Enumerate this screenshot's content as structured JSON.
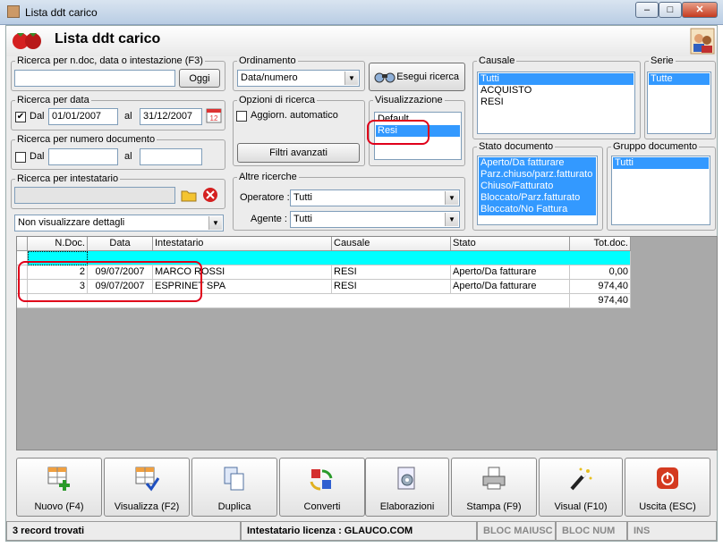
{
  "window": {
    "title": "Lista ddt carico",
    "min_glyph": "–",
    "max_glyph": "□",
    "close_glyph": "✕"
  },
  "header": {
    "title": "Lista ddt carico"
  },
  "search_text": {
    "legend": "Ricerca per n.doc, data o intestazione (F3)",
    "value": "",
    "today_button": "Oggi"
  },
  "ordering": {
    "legend": "Ordinamento",
    "selected": "Data/numero"
  },
  "search_button": {
    "label": "Esegui ricerca"
  },
  "date_search": {
    "legend": "Ricerca per data",
    "checked": true,
    "from_label": "Dal",
    "from_value": "01/01/2007",
    "to_label": "al",
    "to_value": "31/12/2007"
  },
  "search_options": {
    "legend": "Opzioni di ricerca",
    "auto_update_label": "Aggiorn. automatico",
    "advanced_filters": "Filtri avanzati"
  },
  "view": {
    "legend": "Visualizzazione",
    "items": [
      "Default",
      "Resi"
    ],
    "selected": "Resi"
  },
  "number_search": {
    "legend": "Ricerca per numero documento",
    "from_label": "Dal",
    "from_value": "",
    "to_label": "al",
    "to_value": ""
  },
  "holder_search": {
    "legend": "Ricerca per intestatario",
    "value": ""
  },
  "details": {
    "selected": "Non visualizzare dettagli"
  },
  "other_search": {
    "legend": "Altre ricerche",
    "operator_label": "Operatore :",
    "operator_value": "Tutti",
    "agent_label": "Agente :",
    "agent_value": "Tutti"
  },
  "causale": {
    "legend": "Causale",
    "items": [
      "Tutti",
      "ACQUISTO",
      "RESI"
    ],
    "selected": "Tutti"
  },
  "serie": {
    "legend": "Serie",
    "items": [
      "Tutte"
    ],
    "selected": "Tutte"
  },
  "stato": {
    "legend": "Stato documento",
    "items": [
      "Aperto/Da fatturare",
      "Parz.chiuso/parz.fatturato",
      "Chiuso/Fatturato",
      "Bloccato/Parz.fatturato",
      "Bloccato/No Fattura"
    ]
  },
  "gruppo": {
    "legend": "Gruppo documento",
    "items": [
      "Tutti"
    ],
    "selected": "Tutti"
  },
  "table": {
    "headers": [
      "N.Doc.",
      "Data",
      "Intestatario",
      "Causale",
      "Stato",
      "Tot.doc."
    ],
    "rows": [
      [
        "2",
        "09/07/2007",
        "MARCO ROSSI",
        "RESI",
        "Aperto/Da fatturare",
        "0,00"
      ],
      [
        "3",
        "09/07/2007",
        "ESPRINET SPA",
        "RESI",
        "Aperto/Da fatturare",
        "974,40"
      ]
    ],
    "total": "974,40"
  },
  "toolbar": {
    "buttons": [
      {
        "label": "Nuovo (F4)",
        "icon": "grid-add-icon"
      },
      {
        "label": "Visualizza (F2)",
        "icon": "grid-check-icon"
      },
      {
        "label": "Duplica",
        "icon": "duplicate-icon"
      },
      {
        "label": "Converti",
        "icon": "convert-icon"
      },
      {
        "label": "Elaborazioni",
        "icon": "gear-document-icon"
      },
      {
        "label": "Stampa (F9)",
        "icon": "printer-icon"
      },
      {
        "label": "Visual (F10)",
        "icon": "magic-wand-icon"
      },
      {
        "label": "Uscita (ESC)",
        "icon": "power-icon"
      }
    ]
  },
  "status": {
    "records": "3 record trovati",
    "license": "Intestatario licenza : GLAUCO.COM",
    "caps": "BLOC MAIUSC",
    "num": "BLOC NUM",
    "ins": "INS"
  },
  "colors": {
    "selection": "#3399ff",
    "accent_row": "#00ffff",
    "highlight": "#e0001a"
  }
}
